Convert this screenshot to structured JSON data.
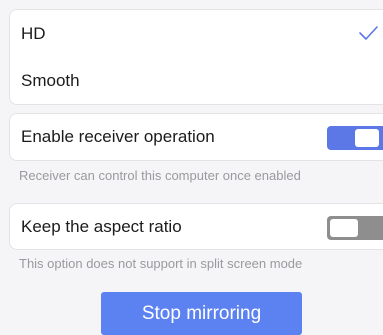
{
  "quality": {
    "options": [
      {
        "label": "HD",
        "selected": true
      },
      {
        "label": "Smooth",
        "selected": false
      }
    ],
    "check_icon": "checkmark-icon"
  },
  "receiver_operation": {
    "label": "Enable receiver operation",
    "enabled": true,
    "hint": "Receiver can control this computer once enabled"
  },
  "aspect_ratio": {
    "label": "Keep the aspect ratio",
    "enabled": false,
    "hint": "This option does not support in split screen mode"
  },
  "actions": {
    "stop_label": "Stop mirroring"
  },
  "colors": {
    "accent": "#5b78e6",
    "button": "#5b82f0",
    "toggle_off": "#8e8e8e",
    "hint_text": "#9a9a9e"
  }
}
